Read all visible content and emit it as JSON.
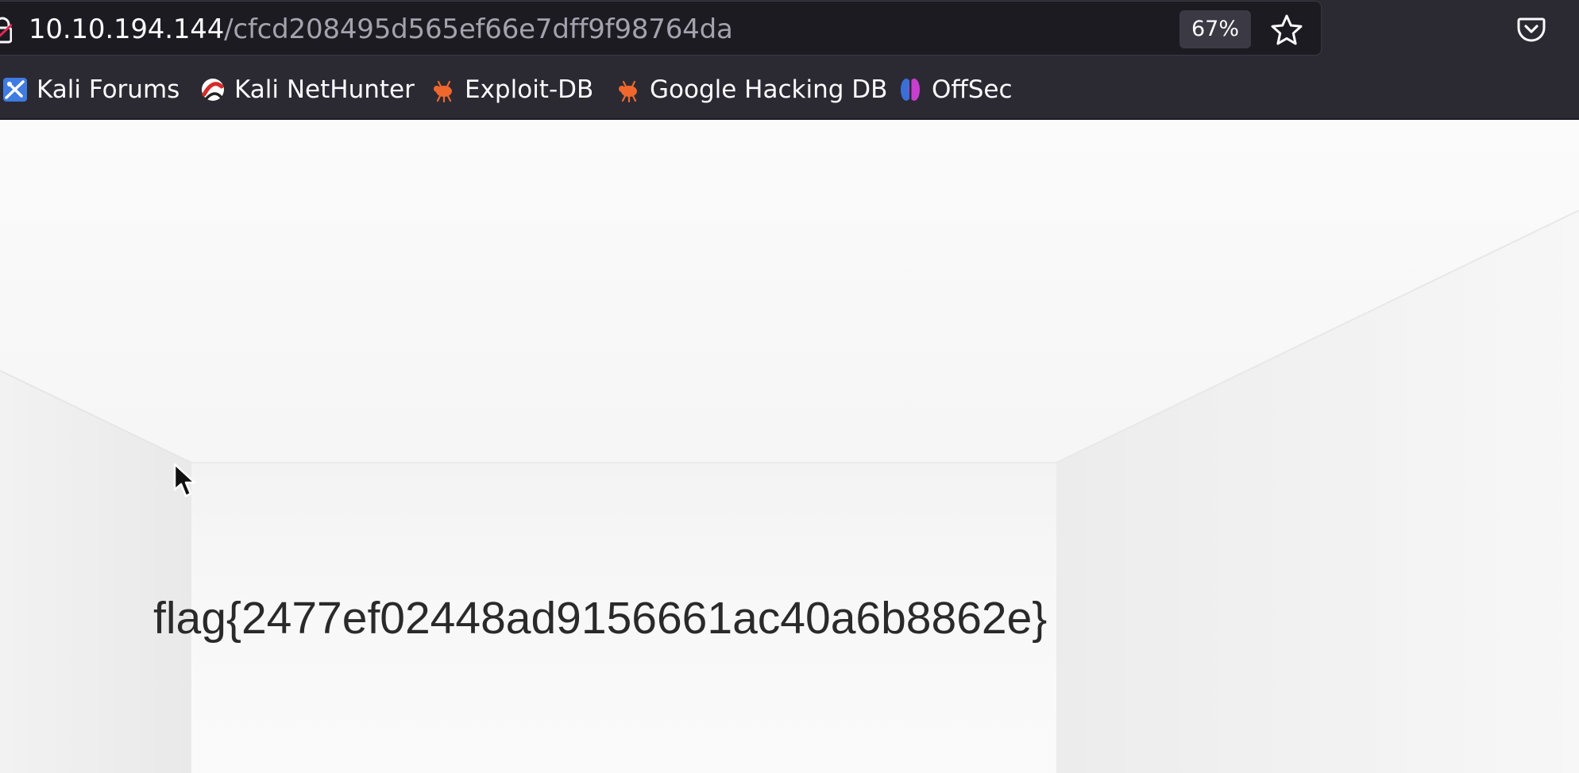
{
  "browser": {
    "url_host": "10.10.194.144",
    "url_path": "/cfcd208495d565ef66e7dff9f98764da",
    "zoom": "67%",
    "icons": {
      "lock": "lock-icon",
      "star": "bookmark-star-icon",
      "pocket": "pocket-icon"
    }
  },
  "bookmarks": [
    {
      "label": "Kali Forums",
      "icon": "kali-forums-icon"
    },
    {
      "label": "Kali NetHunter",
      "icon": "kali-nethunter-icon"
    },
    {
      "label": "Exploit-DB",
      "icon": "exploit-db-icon"
    },
    {
      "label": "Google Hacking DB",
      "icon": "ghdb-icon"
    },
    {
      "label": "OffSec",
      "icon": "offsec-icon"
    }
  ],
  "page": {
    "flag": "flag{2477ef02448ad9156661ac40a6b8862e}"
  },
  "colors": {
    "chrome": "#2b2a33",
    "urlbar": "#1c1b22",
    "page_bg": "#f4f4f4",
    "accent_orange": "#f0672d"
  }
}
